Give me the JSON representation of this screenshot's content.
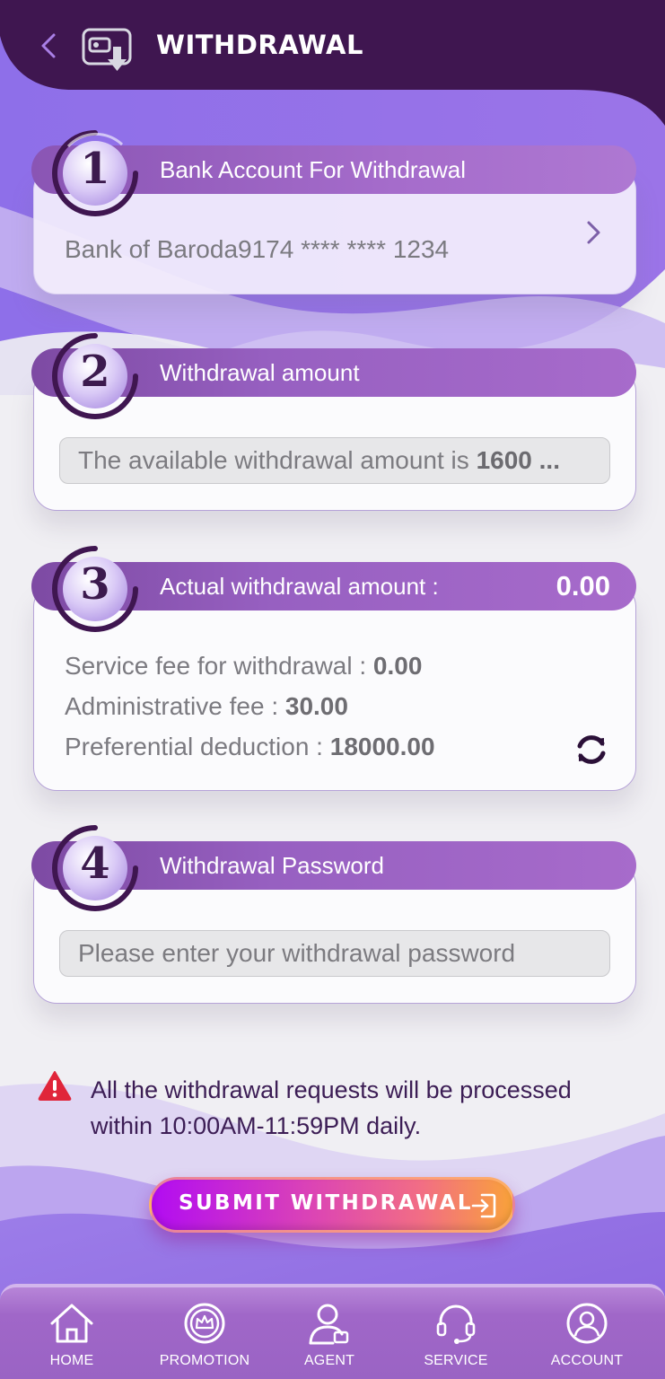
{
  "header": {
    "title": "WITHDRAWAL"
  },
  "steps": [
    {
      "number": "1",
      "title": "Bank Account For Withdrawal"
    },
    {
      "number": "2",
      "title": "Withdrawal amount"
    },
    {
      "number": "3",
      "title": "Actual withdrawal amount :",
      "value": "0.00"
    },
    {
      "number": "4",
      "title": "Withdrawal Password"
    }
  ],
  "bank": {
    "account_text": "Bank of Baroda9174 **** **** 1234"
  },
  "amount": {
    "prefix": "The available withdrawal amount is ",
    "value": "1600 ..."
  },
  "fees": [
    {
      "label": "Service fee for withdrawal : ",
      "value": "0.00"
    },
    {
      "label": "Administrative fee : ",
      "value": "30.00"
    },
    {
      "label": "Preferential deduction : ",
      "value": "18000.00"
    }
  ],
  "password": {
    "placeholder": "Please enter your withdrawal password",
    "value": ""
  },
  "notice": {
    "text": "All the withdrawal requests will be processed within 10:00AM-11:59PM daily."
  },
  "submit": {
    "label": "SUBMIT WITHDRAWAL"
  },
  "nav": [
    {
      "label": "HOME",
      "icon": "home-icon"
    },
    {
      "label": "PROMOTION",
      "icon": "crown-icon"
    },
    {
      "label": "AGENT",
      "icon": "agent-icon"
    },
    {
      "label": "SERVICE",
      "icon": "headset-icon"
    },
    {
      "label": "ACCOUNT",
      "icon": "user-icon"
    }
  ],
  "colors": {
    "header_dark": "#3f1650",
    "ribbon": "#9760c1",
    "accent_purple": "#8f6ae6",
    "submit_start": "#b20cf2",
    "submit_end": "#f9a23a",
    "warning_red": "#e0253a"
  }
}
